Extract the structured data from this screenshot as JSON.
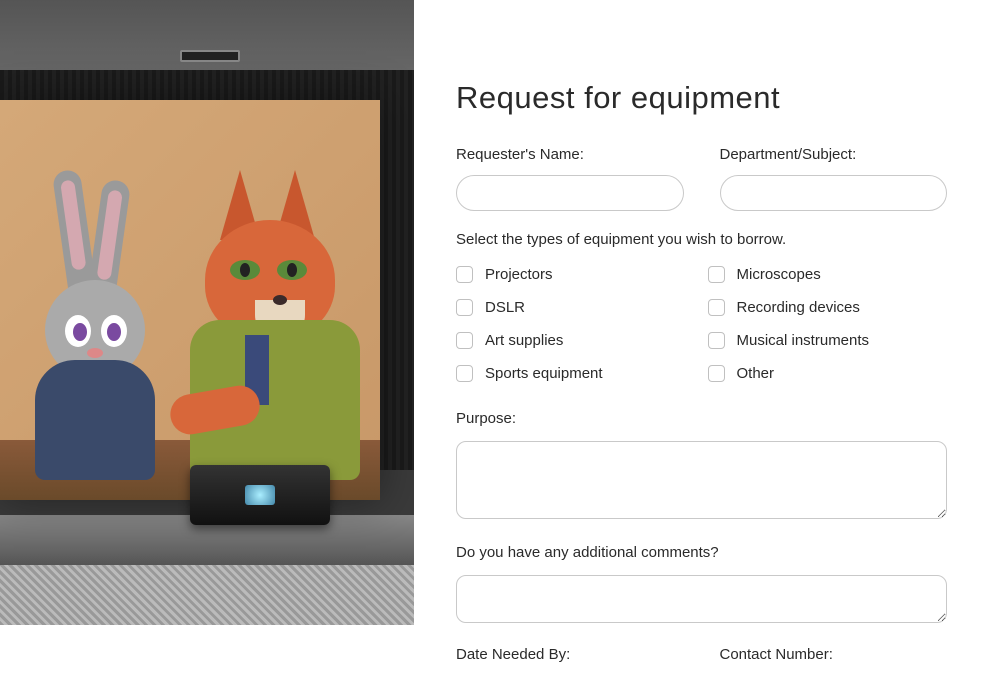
{
  "form": {
    "title": "Request for equipment",
    "requester_name_label": "Requester's Name:",
    "department_label": "Department/Subject:",
    "equipment_prompt": "Select the types of equipment you wish to borrow.",
    "equipment_options": {
      "projectors": "Projectors",
      "microscopes": "Microscopes",
      "dslr": "DSLR",
      "recording": "Recording devices",
      "art": "Art supplies",
      "musical": "Musical instruments",
      "sports": "Sports equipment",
      "other": "Other"
    },
    "purpose_label": "Purpose:",
    "comments_label": "Do you have any additional comments?",
    "date_needed_label": "Date Needed By:",
    "contact_label": "Contact Number:"
  }
}
